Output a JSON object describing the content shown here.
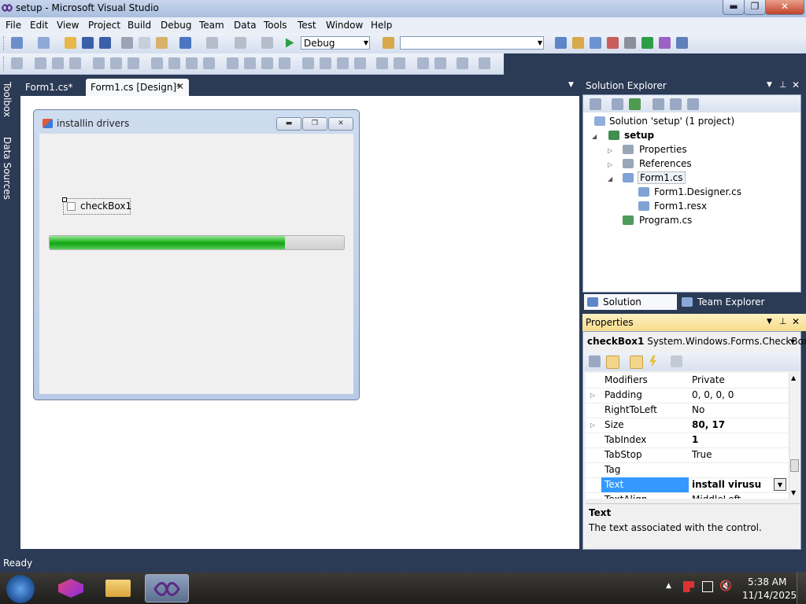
{
  "window": {
    "title": "setup - Microsoft Visual Studio",
    "min_glyph": "▬",
    "max_glyph": "❐",
    "close_glyph": "✕"
  },
  "menu": [
    "File",
    "Edit",
    "View",
    "Project",
    "Build",
    "Debug",
    "Team",
    "Data",
    "Tools",
    "Test",
    "Window",
    "Help"
  ],
  "toolbar": {
    "configuration": "Debug",
    "platform": ""
  },
  "left_panels": [
    "Toolbox",
    "Data Sources"
  ],
  "tabs": [
    {
      "label": "Form1.cs*"
    },
    {
      "label": "Form1.cs [Design]*"
    }
  ],
  "form": {
    "title": "installin drivers",
    "checkbox_label": "checkBox1",
    "progress_fraction": 0.8
  },
  "solution_explorer": {
    "title": "Solution Explorer",
    "solution": "Solution 'setup' (1 project)",
    "project": "setup",
    "items": [
      "Properties",
      "References",
      "Form1.cs",
      "Form1.Designer.cs",
      "Form1.resx",
      "Program.cs"
    ]
  },
  "bottom_tabs": [
    "Solution Explorer",
    "Team Explorer"
  ],
  "properties": {
    "title": "Properties",
    "object_name": "checkBox1",
    "object_type": "System.Windows.Forms.CheckBox",
    "rows": [
      {
        "name": "Modifiers",
        "value": "Private"
      },
      {
        "name": "Padding",
        "value": "0, 0, 0, 0"
      },
      {
        "name": "RightToLeft",
        "value": "No"
      },
      {
        "name": "Size",
        "value": "80, 17"
      },
      {
        "name": "TabIndex",
        "value": "1"
      },
      {
        "name": "TabStop",
        "value": "True"
      },
      {
        "name": "Tag",
        "value": ""
      },
      {
        "name": "Text",
        "value": "install virusu"
      },
      {
        "name": "TextAlign",
        "value": "MiddleLeft"
      }
    ],
    "desc_title": "Text",
    "desc_text": "The text associated with the control."
  },
  "status": "Ready",
  "taskbar": {
    "time": "5:38 AM",
    "date": "11/14/2025"
  },
  "colors": {
    "selection": "#3399ff",
    "progress": "#1fb51f",
    "dark_bg": "#2b3a55"
  }
}
